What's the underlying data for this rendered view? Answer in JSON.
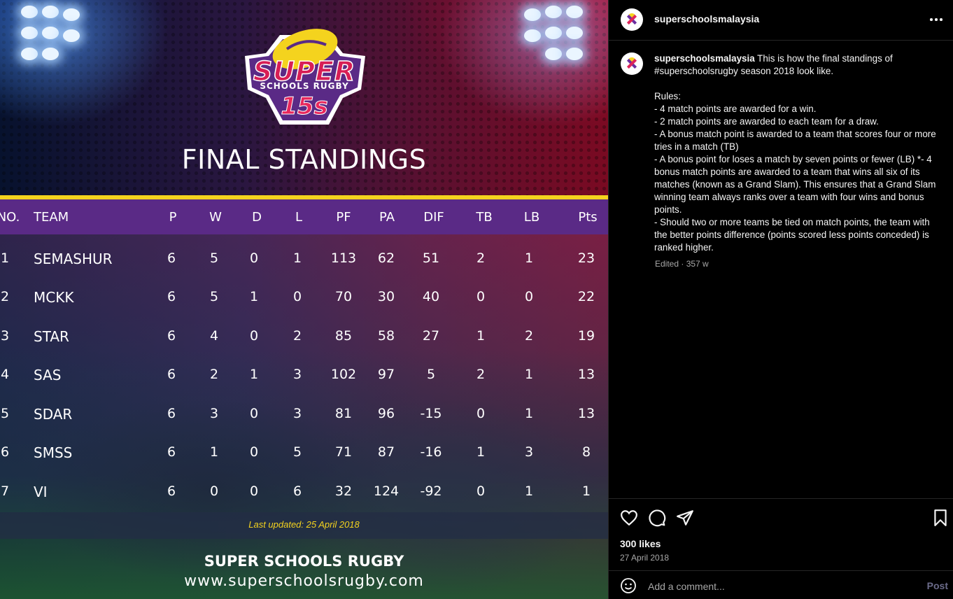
{
  "post": {
    "username": "superschoolsmalaysia",
    "logo": {
      "super": "SUPER",
      "subtitle": "SCHOOLS RUGBY",
      "fifteens": "15s"
    },
    "title": "FINAL STANDINGS",
    "columns": [
      "NO.",
      "TEAM",
      "P",
      "W",
      "D",
      "L",
      "PF",
      "PA",
      "DIF",
      "TB",
      "LB",
      "Pts"
    ],
    "rows": [
      {
        "no": "1",
        "team": "SEMASHUR",
        "p": "6",
        "w": "5",
        "d": "0",
        "l": "1",
        "pf": "113",
        "pa": "62",
        "dif": "51",
        "tb": "2",
        "lb": "1",
        "pts": "23"
      },
      {
        "no": "2",
        "team": "MCKK",
        "p": "6",
        "w": "5",
        "d": "1",
        "l": "0",
        "pf": "70",
        "pa": "30",
        "dif": "40",
        "tb": "0",
        "lb": "0",
        "pts": "22"
      },
      {
        "no": "3",
        "team": "STAR",
        "p": "6",
        "w": "4",
        "d": "0",
        "l": "2",
        "pf": "85",
        "pa": "58",
        "dif": "27",
        "tb": "1",
        "lb": "2",
        "pts": "19"
      },
      {
        "no": "4",
        "team": "SAS",
        "p": "6",
        "w": "2",
        "d": "1",
        "l": "3",
        "pf": "102",
        "pa": "97",
        "dif": "5",
        "tb": "2",
        "lb": "1",
        "pts": "13"
      },
      {
        "no": "5",
        "team": "SDAR",
        "p": "6",
        "w": "3",
        "d": "0",
        "l": "3",
        "pf": "81",
        "pa": "96",
        "dif": "-15",
        "tb": "0",
        "lb": "1",
        "pts": "13"
      },
      {
        "no": "6",
        "team": "SMSS",
        "p": "6",
        "w": "1",
        "d": "0",
        "l": "5",
        "pf": "71",
        "pa": "87",
        "dif": "-16",
        "tb": "1",
        "lb": "3",
        "pts": "8"
      },
      {
        "no": "7",
        "team": "VI",
        "p": "6",
        "w": "0",
        "d": "0",
        "l": "6",
        "pf": "32",
        "pa": "124",
        "dif": "-92",
        "tb": "0",
        "lb": "1",
        "pts": "1"
      }
    ],
    "last_updated": "Last updated: 25 April 2018",
    "footer_brand": "SUPER SCHOOLS RUGBY",
    "footer_url": "www.superschoolsrugby.com"
  },
  "sidebar": {
    "username": "superschoolsmalaysia",
    "more_icon": "more-horizontal-icon",
    "caption_user": "superschoolsmalaysia",
    "caption_text": " This is how the final standings of #superschoolsrugby season 2018 look like.\n\nRules:\n- 4 match points are awarded for a win.\n- 2 match points are awarded to each team for a draw.\n- A bonus match point is awarded to a team that scores four or more tries in a match (TB)\n- A bonus point for loses a match by seven points or fewer (LB) *- 4 bonus match points are awarded to a team that wins all six of its matches (known as a Grand Slam). This ensures that a Grand Slam winning team always ranks over a team with four wins and bonus points.\n- Should two or more teams be tied on match points, the team with the better points difference (points scored less points conceded) is ranked higher.",
    "caption_meta": "Edited · 357 w",
    "likes": "300 likes",
    "date": "27 April 2018",
    "comment_placeholder": "Add a comment...",
    "post_label": "Post"
  },
  "colors": {
    "header_bar": "#5a2a86",
    "accent_yellow": "#f4d31e",
    "brand_pink": "#e0265b",
    "post_button": "#6b6b8a"
  }
}
